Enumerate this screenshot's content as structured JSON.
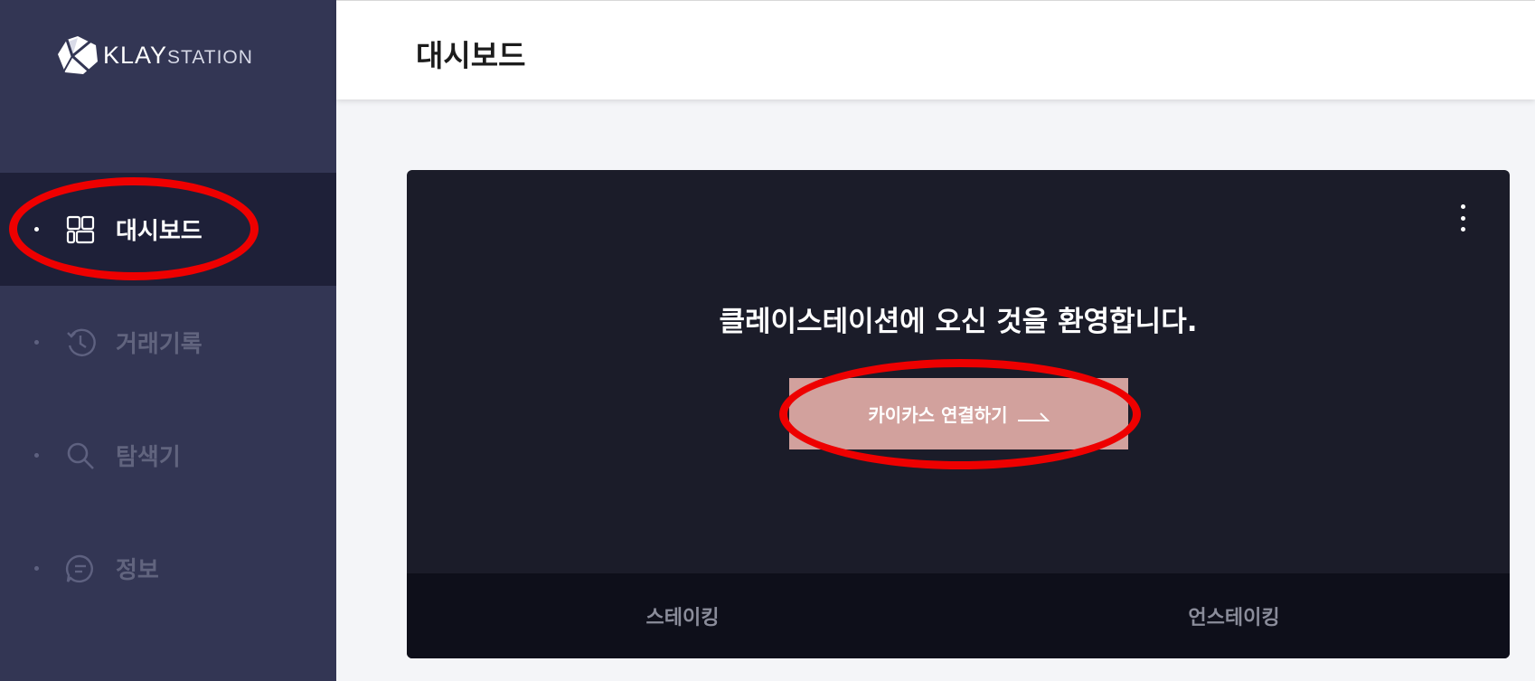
{
  "brand": {
    "name_bold": "KLAY",
    "name_light": "STATION"
  },
  "sidebar": {
    "items": [
      {
        "label": "대시보드",
        "icon": "dashboard-icon",
        "active": true
      },
      {
        "label": "거래기록",
        "icon": "history-icon",
        "active": false
      },
      {
        "label": "탐색기",
        "icon": "search-icon",
        "active": false
      },
      {
        "label": "정보",
        "icon": "info-chat-icon",
        "active": false
      }
    ]
  },
  "header": {
    "title": "대시보드"
  },
  "card": {
    "welcome": "클레이스테이션에 오신 것을 환영합니다.",
    "connect_label": "카이카스 연결하기",
    "tabs": [
      {
        "label": "스테이킹"
      },
      {
        "label": "언스테이킹"
      }
    ]
  },
  "colors": {
    "sidebar_bg": "#333654",
    "sidebar_active_bg": "#1e2038",
    "card_bg": "#1b1c29",
    "connect_button": "#d2a19d",
    "annotation": "#ee0000"
  }
}
